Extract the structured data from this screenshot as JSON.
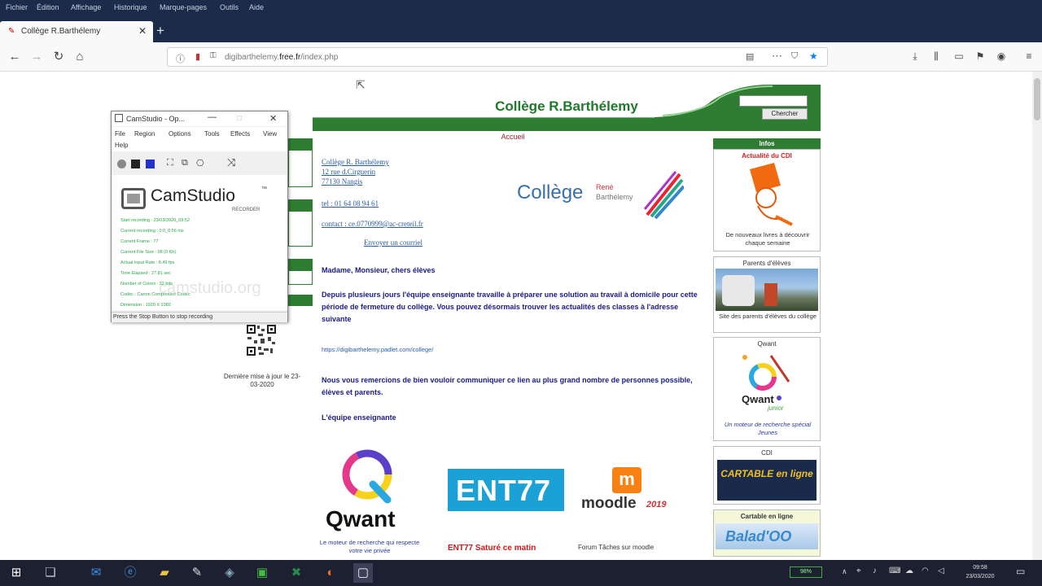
{
  "browser": {
    "menus": [
      "Fichier",
      "Édition",
      "Affichage",
      "Historique",
      "Marque-pages",
      "Outils",
      "Aide"
    ],
    "tab_title": "Collège R.Barthélemy",
    "url_prefix": "digibarthelemy.",
    "url_domain": "free.fr",
    "url_suffix": "/index.php",
    "colors": {
      "chrome_dark": "#1c2b4a",
      "accent_blue": "#0a84ff"
    }
  },
  "site": {
    "title": "Collège R.Barthélemy",
    "search_button": "Chercher",
    "nav_accueil": "Accueil",
    "address": [
      "Collège R. Barthélemy",
      "12 rue d.Cirguerin",
      "77130 Nangis"
    ],
    "tel": "tel : 01 64 08 94 61",
    "contact": "contact : ce.0770999@ac-creteil.fr",
    "send_mail": "Envoyer un courriel",
    "logo_text": "Collège",
    "logo_small_1": "René",
    "logo_small_2": "Barthélemy",
    "greeting": "Madame, Monsieur, chers élèves",
    "paragraph": "Depuis plusieurs jours l'équipe enseignante travaille à préparer une solution au travail à domicile pour cette période de fermeture du collège. Vous pouvez désormais trouver les actualités des classes à l'adresse suivante",
    "padlet_url": "https://digibarthelemy.padlet.com/college/",
    "thanks": "Nous vous remercions de bien vouloir communiquer ce lien au plus grand nombre de personnes possible, élèves et parents.",
    "signature": "L'équipe enseignante",
    "last_modified": "Dernière mise à jour le 23-03-2020",
    "qwant_logo": "Qwant",
    "qwant_caption": "Le moteur de recherche qui respecte votre vie privée",
    "ent_logo": "ENT77",
    "ent_caption": "ENT77 Saturé ce matin",
    "moodle_logo": "moodle",
    "moodle_year": "2019",
    "moodle_caption": "Forum Tâches sur moodle"
  },
  "sidebar": {
    "infos_header": "Infos",
    "cdi_title": "Actualité du CDI",
    "cdi_caption": "De nouveaux livres à découvrir chaque semaine",
    "parents_title": "Parents d'élèves",
    "parents_caption": "Site des parents d'élèves du collège",
    "qwant_title": "Qwant",
    "qwant_caption": "Un moteur de recherche spécial Jeunes",
    "qwant_junior": "junior",
    "cdi2_title": "CDI",
    "cartable_text": "CARTABLE en ligne",
    "cartable_title": "Cartable en ligne",
    "balad_text": "Balad'OO"
  },
  "camstudio": {
    "title": "CamStudio - Op...",
    "menus": [
      "File",
      "Region",
      "Options",
      "Tools",
      "Effects",
      "View",
      "Help"
    ],
    "logo": "CamStudio",
    "logo_sub": "RECORDER",
    "tm": "™",
    "watermark": "camstudio.org",
    "stats": [
      "Start recording : 23/03/2020_09:52",
      "Current recording : 0:0_0:56 ms",
      "Current Frame : 77",
      "Current File Size : 98 (0 Kb)",
      "Actual Input Rate : 8.49 fps",
      "Time Elapsed : 27.81 sec",
      "Number of Colors : 32 bits",
      "Codec : Canon Compressor Codec",
      "Dimension : 1920 X 1080"
    ],
    "status": "Press the Stop Button to stop recording"
  },
  "taskbar": {
    "clock_time": "09:58",
    "clock_date": "23/03/2020",
    "battery": "98%"
  }
}
